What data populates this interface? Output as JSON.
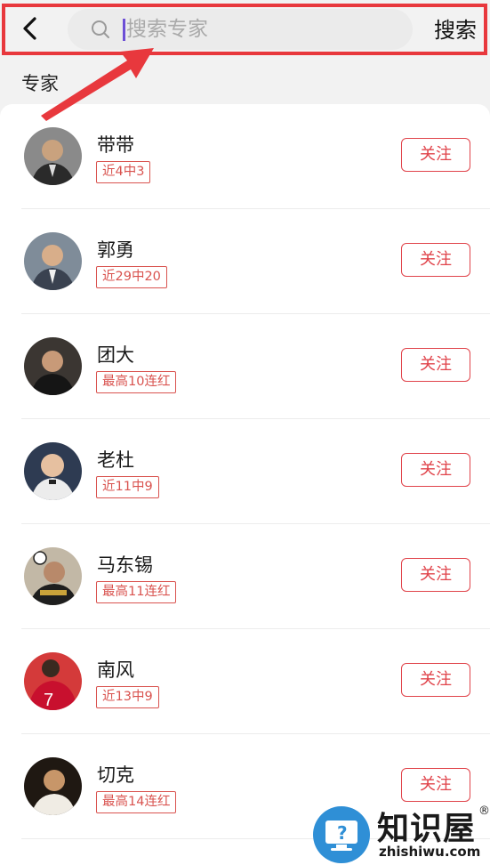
{
  "header": {
    "search_placeholder": "搜索专家",
    "search_label": "搜索"
  },
  "section": {
    "title": "专家"
  },
  "follow_label": "关注",
  "experts": [
    {
      "name": "带带",
      "tag": "近4中3"
    },
    {
      "name": "郭勇",
      "tag": "近29中20"
    },
    {
      "name": "团大",
      "tag": "最高10连红"
    },
    {
      "name": "老杜",
      "tag": "近11中9"
    },
    {
      "name": "马东锡",
      "tag": "最高11连红"
    },
    {
      "name": "南风",
      "tag": "近13中9"
    },
    {
      "name": "切克",
      "tag": "最高14连红"
    }
  ],
  "watermark": {
    "title": "知识屋",
    "reg": "®",
    "url": "zhishiwu.com"
  },
  "colors": {
    "accent": "#e0434a",
    "annotation": "#e8383d",
    "watermark_blue": "#2f8fd6"
  }
}
